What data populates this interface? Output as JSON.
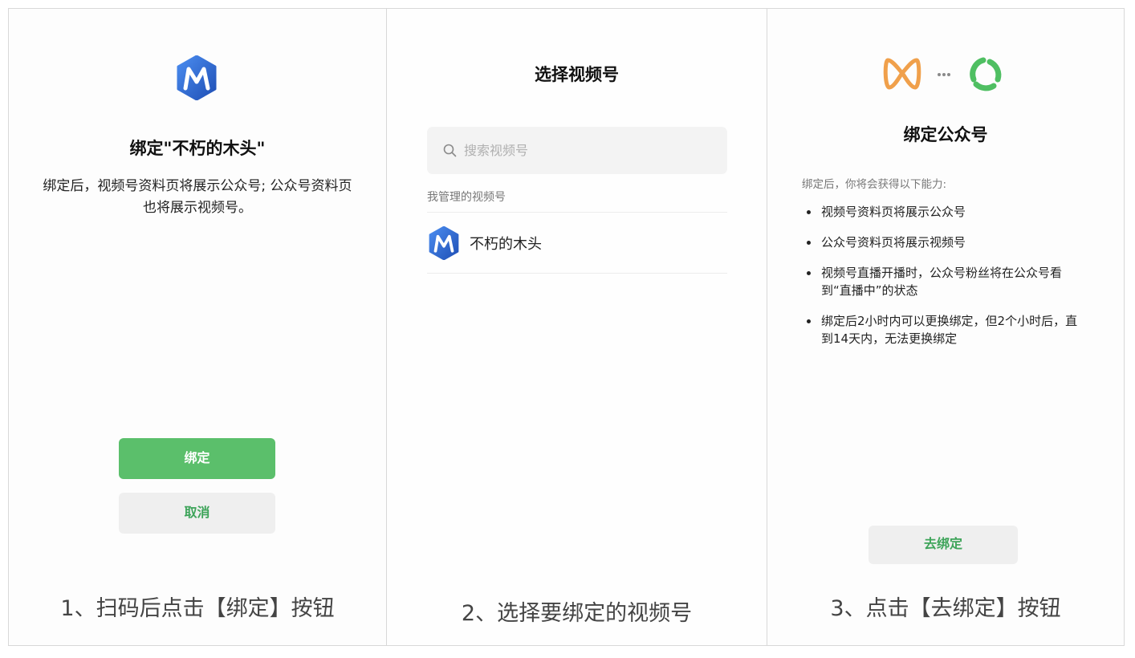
{
  "colors": {
    "accent_green": "#5bbf6b",
    "link_green": "#3ea45a",
    "brand_blue": "#2f6fd6",
    "brand_orange": "#f0a04b"
  },
  "step1": {
    "logo_icon": "channel-m-logo",
    "title": "绑定\"不朽的木头\"",
    "description": "绑定后，视频号资料页将展示公众号; 公众号资料页也将展示视频号。",
    "bind_label": "绑定",
    "cancel_label": "取消",
    "caption": "1、扫码后点击【绑定】按钮"
  },
  "step2": {
    "title": "选择视频号",
    "search": {
      "placeholder": "搜索视频号",
      "value": ""
    },
    "section_label": "我管理的视频号",
    "channels": [
      {
        "name": "不朽的木头",
        "icon": "channel-m-logo"
      }
    ],
    "caption": "2、选择要绑定的视频号"
  },
  "step3": {
    "icons": [
      "butterfly-logo",
      "ellipsis-icon",
      "green-swirl-logo"
    ],
    "title": "绑定公众号",
    "intro": "绑定后，你将会获得以下能力:",
    "benefits": [
      "视频号资料页将展示公众号",
      "公众号资料页将展示视频号",
      "视频号直播开播时，公众号粉丝将在公众号看到“直播中”的状态",
      "绑定后2小时内可以更换绑定，但2个小时后，直到14天内，无法更换绑定"
    ],
    "go_bind_label": "去绑定",
    "caption": "3、点击【去绑定】按钮"
  }
}
